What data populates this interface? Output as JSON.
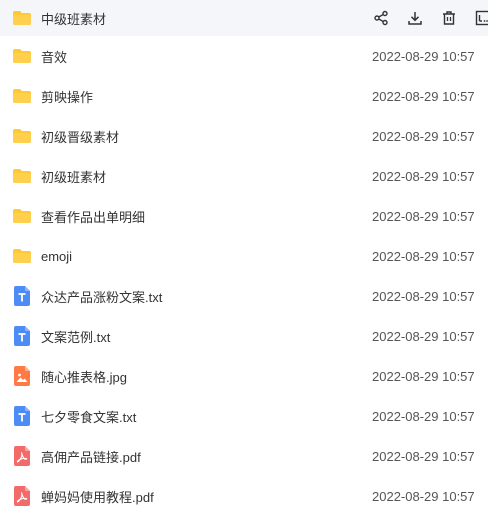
{
  "colors": {
    "folder": "#FFC933",
    "txt": "#4D8CF5",
    "jpg": "#FF7A45",
    "pdf": "#F26A6A"
  },
  "row_actions": [
    "share-icon",
    "download-icon",
    "delete-icon",
    "more-icon"
  ],
  "files": [
    {
      "name": "中级班素材",
      "date": "",
      "type": "folder",
      "icon": "folder-icon"
    },
    {
      "name": "音效",
      "date": "2022-08-29 10:57",
      "type": "folder",
      "icon": "folder-icon"
    },
    {
      "name": "剪映操作",
      "date": "2022-08-29 10:57",
      "type": "folder",
      "icon": "folder-icon"
    },
    {
      "name": "初级晋级素材",
      "date": "2022-08-29 10:57",
      "type": "folder",
      "icon": "folder-icon"
    },
    {
      "name": "初级班素材",
      "date": "2022-08-29 10:57",
      "type": "folder",
      "icon": "folder-icon"
    },
    {
      "name": "查看作品出单明细",
      "date": "2022-08-29 10:57",
      "type": "folder",
      "icon": "folder-icon"
    },
    {
      "name": "emoji",
      "date": "2022-08-29 10:57",
      "type": "folder",
      "icon": "folder-icon"
    },
    {
      "name": "众达产品涨粉文案.txt",
      "date": "2022-08-29 10:57",
      "type": "txt",
      "icon": "txt-file-icon"
    },
    {
      "name": "文案范例.txt",
      "date": "2022-08-29 10:57",
      "type": "txt",
      "icon": "txt-file-icon"
    },
    {
      "name": "随心推表格.jpg",
      "date": "2022-08-29 10:57",
      "type": "jpg",
      "icon": "image-file-icon"
    },
    {
      "name": "七夕零食文案.txt",
      "date": "2022-08-29 10:57",
      "type": "txt",
      "icon": "txt-file-icon"
    },
    {
      "name": "高佣产品链接.pdf",
      "date": "2022-08-29 10:57",
      "type": "pdf",
      "icon": "pdf-file-icon"
    },
    {
      "name": "蝉妈妈使用教程.pdf",
      "date": "2022-08-29 10:57",
      "type": "pdf",
      "icon": "pdf-file-icon"
    }
  ]
}
